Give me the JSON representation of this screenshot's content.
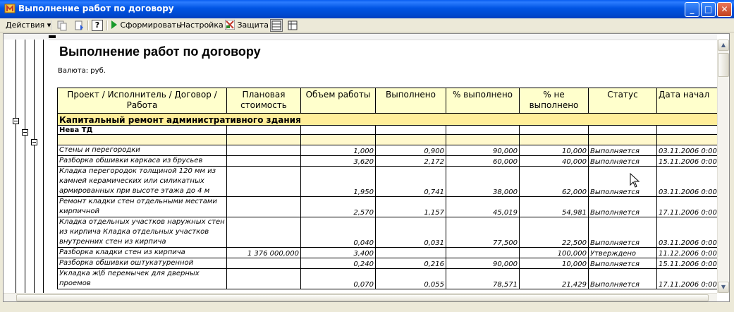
{
  "window": {
    "title": "Выполнение работ по договору",
    "minimize": "_",
    "maximize": "□",
    "close": "✕"
  },
  "toolbar": {
    "actions_label": "Действия",
    "generate_label": "Сформировать",
    "settings_label": "Настройка",
    "protection_label": "Защита",
    "help_label": "?"
  },
  "report": {
    "title": "Выполнение работ по договору",
    "currency": "Валюта: руб.",
    "columns": [
      "Проект / Исполнитель / Договор / Работа",
      "Плановая стоимость",
      "Объем работы",
      "Выполнено",
      "% выполнено",
      "% не выполнено",
      "Статус",
      "Дата начал"
    ],
    "group_title": "Капитальный ремонт административного здания",
    "contractor": "Нева ТД",
    "rows": [
      {
        "work": "Стены и перегородки",
        "plan": "",
        "volume": "1,000",
        "done": "0,900",
        "pct_done": "90,000",
        "pct_not": "10,000",
        "status": "Выполняется",
        "date": "03.11.2006 0:00:"
      },
      {
        "work": "Разборка обшивки каркаса из брусьев",
        "plan": "",
        "volume": "3,620",
        "done": "2,172",
        "pct_done": "60,000",
        "pct_not": "40,000",
        "status": "Выполняется",
        "date": "15.11.2006 0:00:"
      },
      {
        "work": "Кладка перегородок толщиной 120 мм из камней керамических или силикатных армированных при высоте этажа до 4 м",
        "plan": "",
        "volume": "1,950",
        "done": "0,741",
        "pct_done": "38,000",
        "pct_not": "62,000",
        "status": "Выполняется",
        "date": "03.11.2006 0:00:"
      },
      {
        "work": "Ремонт кладки стен отдельными местами кирпичной",
        "plan": "",
        "volume": "2,570",
        "done": "1,157",
        "pct_done": "45,019",
        "pct_not": "54,981",
        "status": "Выполняется",
        "date": "17.11.2006 0:00:"
      },
      {
        "work": "Кладка отдельных участков наружных стен из кирпича Кладка отдельных участков внутренних стен из кирпича",
        "plan": "",
        "volume": "0,040",
        "done": "0,031",
        "pct_done": "77,500",
        "pct_not": "22,500",
        "status": "Выполняется",
        "date": "03.11.2006 0:00:"
      },
      {
        "work": "Разборка кладки стен из кирпича",
        "plan": "1 376 000,000",
        "volume": "3,400",
        "done": "",
        "pct_done": "",
        "pct_not": "100,000",
        "status": "Утверждено",
        "date": "11.12.2006 0:00:"
      },
      {
        "work": "Разборка обшивки оштукатуренной",
        "plan": "",
        "volume": "0,240",
        "done": "0,216",
        "pct_done": "90,000",
        "pct_not": "10,000",
        "status": "Выполняется",
        "date": "15.11.2006 0:00:"
      },
      {
        "work": "Укладка ж\\б перемычек для дверных проемов",
        "plan": "",
        "volume": "0,070",
        "done": "0,055",
        "pct_done": "78,571",
        "pct_not": "21,429",
        "status": "Выполняется",
        "date": "17.11.2006 0:00:"
      }
    ]
  },
  "colors": {
    "title_bar": "#0054e3",
    "header_fill": "#ffffcc",
    "group_fill": "#ffee99",
    "blank_fill": "#fff8cc"
  },
  "icons": [
    "app-icon",
    "copy-icon",
    "refresh-icon",
    "help-icon",
    "play-icon",
    "protection-icon",
    "table-view-icon",
    "layout-icon"
  ]
}
